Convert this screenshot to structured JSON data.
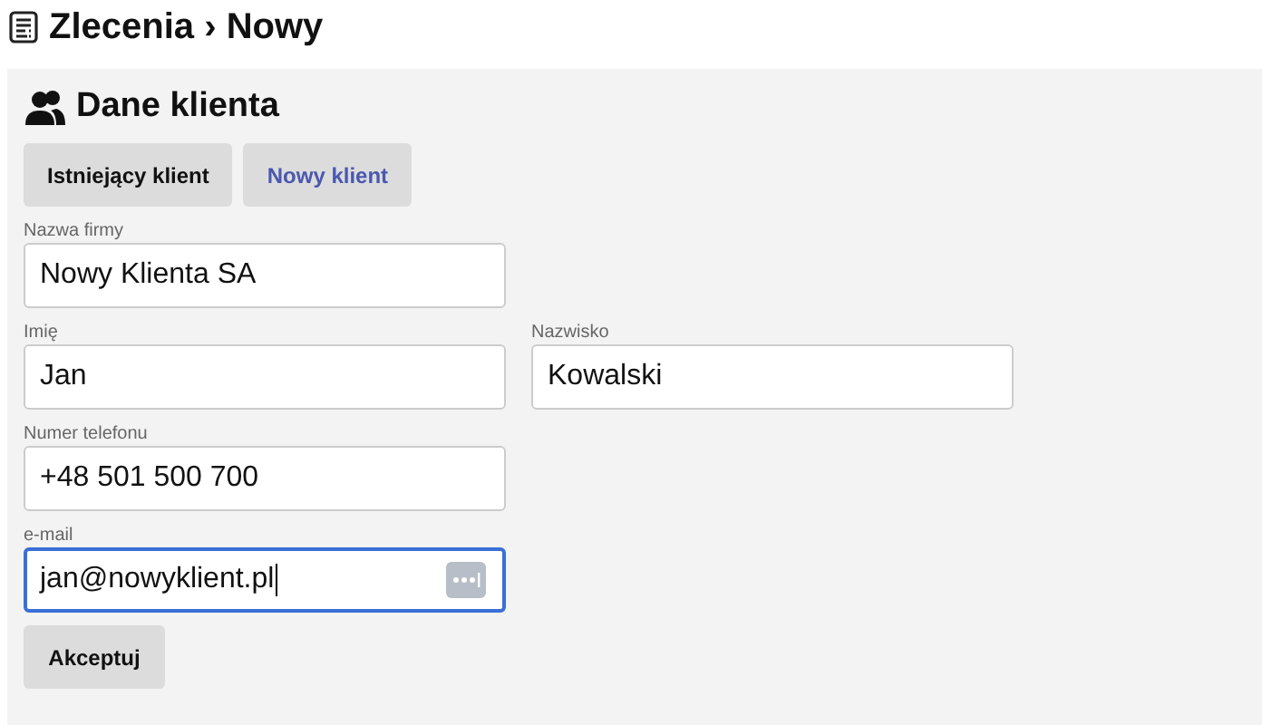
{
  "page": {
    "title": "Zlecenia › Nowy"
  },
  "section": {
    "title": "Dane klienta"
  },
  "tabs": [
    {
      "label": "Istniejący klient",
      "selected": false
    },
    {
      "label": "Nowy klient",
      "selected": true
    }
  ],
  "rows": [
    {
      "fields": [
        {
          "label": "Nazwa firmy",
          "value": "Nowy Klienta SA",
          "focused": false
        }
      ]
    },
    {
      "fields": [
        {
          "label": "Imię",
          "value": "Jan",
          "focused": false
        },
        {
          "label": "Nazwisko",
          "value": "Kowalski",
          "focused": false
        }
      ]
    },
    {
      "fields": [
        {
          "label": "Numer telefonu",
          "value": "+48 501 500 700",
          "focused": false
        }
      ]
    },
    {
      "fields": [
        {
          "label": "e-mail",
          "value": "jan@nowyklient.pl",
          "focused": true
        }
      ]
    }
  ],
  "submit": {
    "label": "Akceptuj"
  }
}
